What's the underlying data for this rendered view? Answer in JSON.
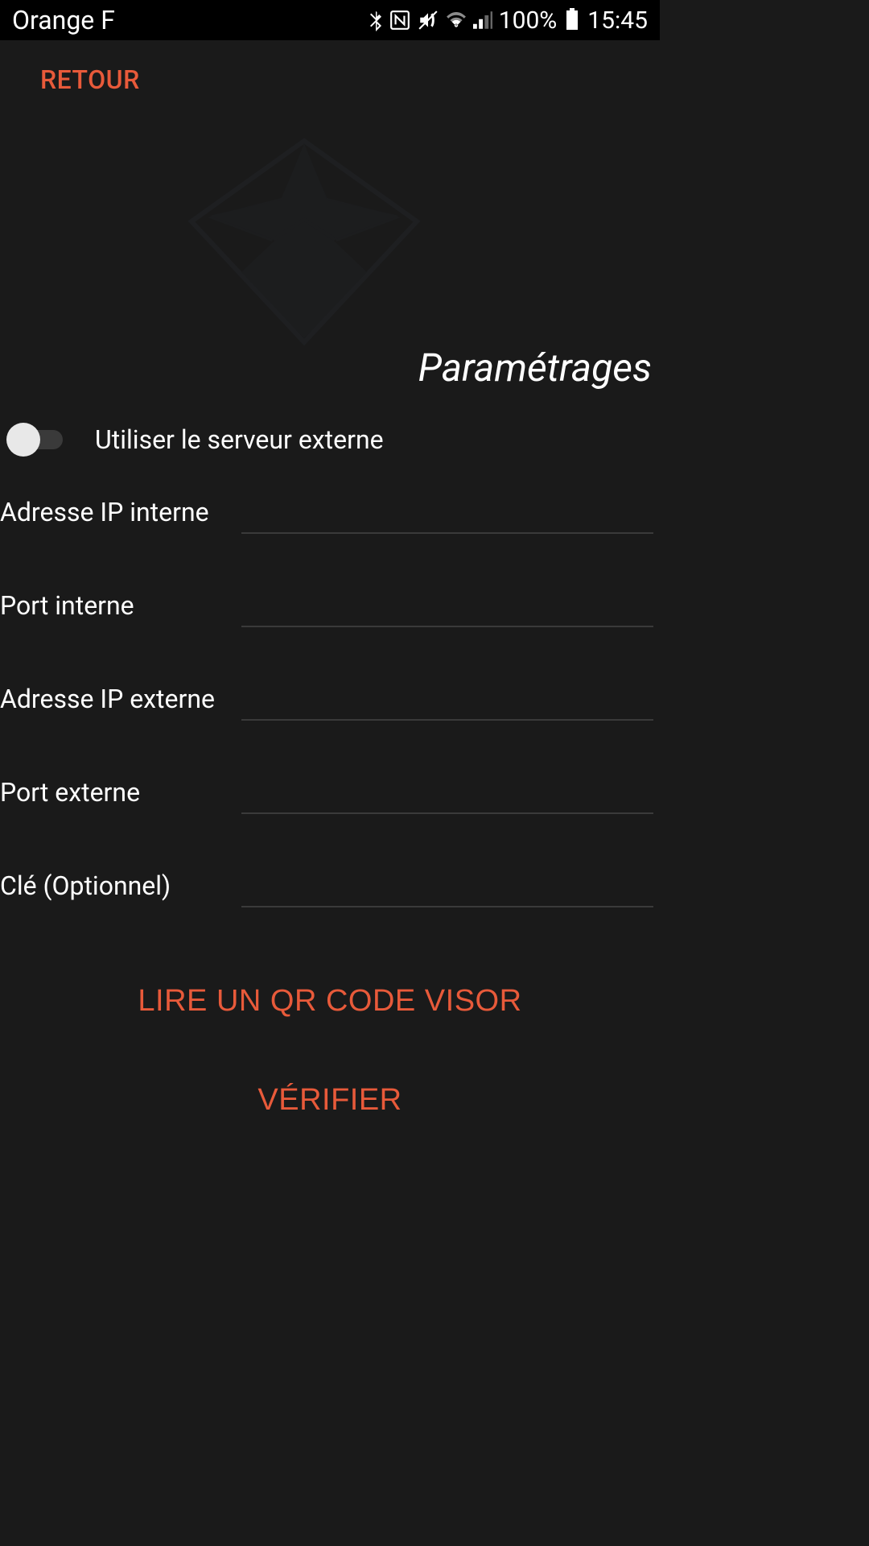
{
  "statusBar": {
    "carrier": "Orange F",
    "battery": "100%",
    "time": "15:45"
  },
  "nav": {
    "back": "RETOUR"
  },
  "page": {
    "title": "Paramétrages"
  },
  "toggle": {
    "label": "Utiliser le serveur externe"
  },
  "fields": {
    "internalIp": {
      "label": "Adresse IP interne",
      "value": ""
    },
    "internalPort": {
      "label": "Port interne",
      "value": ""
    },
    "externalIp": {
      "label": "Adresse IP externe",
      "value": ""
    },
    "externalPort": {
      "label": "Port externe",
      "value": ""
    },
    "key": {
      "label": "Clé (Optionnel)",
      "value": ""
    }
  },
  "actions": {
    "scanQr": "LIRE UN QR CODE VISOR",
    "verify": "VÉRIFIER"
  },
  "colors": {
    "accent": "#e85a3a",
    "background": "#1a1a1a"
  }
}
